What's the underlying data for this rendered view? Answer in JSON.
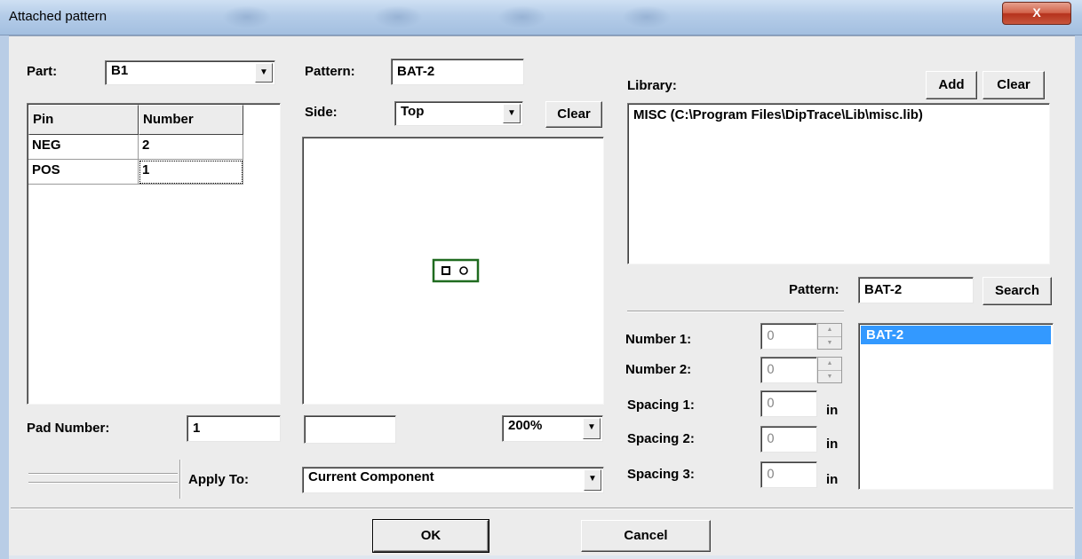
{
  "window": {
    "title": "Attached pattern",
    "close_glyph": "X"
  },
  "part": {
    "label": "Part:",
    "value": "B1",
    "pin_table": {
      "headers": [
        "Pin",
        "Number"
      ],
      "rows": [
        {
          "pin": "NEG",
          "number": "2"
        },
        {
          "pin": "POS",
          "number": "1"
        }
      ]
    },
    "pad_number_label": "Pad Number:",
    "pad_number_value": "1",
    "apply_to_label": "Apply To:"
  },
  "pattern": {
    "label": "Pattern:",
    "value": "BAT-2",
    "side_label": "Side:",
    "side_value": "Top",
    "clear_label": "Clear",
    "coord_value": "",
    "zoom_value": "200%",
    "apply_to_value": "Current Component"
  },
  "library": {
    "label": "Library:",
    "add_label": "Add",
    "clear_label": "Clear",
    "items": [
      "MISC (C:\\Program Files\\DipTrace\\Lib\\misc.lib)"
    ],
    "search_pattern_label": "Pattern:",
    "search_pattern_value": "BAT-2",
    "search_label": "Search",
    "results": [
      "BAT-2"
    ]
  },
  "params": {
    "number1_label": "Number 1:",
    "number1_value": "0",
    "number2_label": "Number 2:",
    "number2_value": "0",
    "spacing1_label": "Spacing 1:",
    "spacing1_value": "0",
    "spacing2_label": "Spacing 2:",
    "spacing2_value": "0",
    "spacing3_label": "Spacing 3:",
    "spacing3_value": "0",
    "unit": "in"
  },
  "footer": {
    "ok_label": "OK",
    "cancel_label": "Cancel"
  },
  "colors": {
    "pattern_outline": "#1f6b1f",
    "selection": "#3399ff",
    "dialog_bg": "#ececec"
  }
}
